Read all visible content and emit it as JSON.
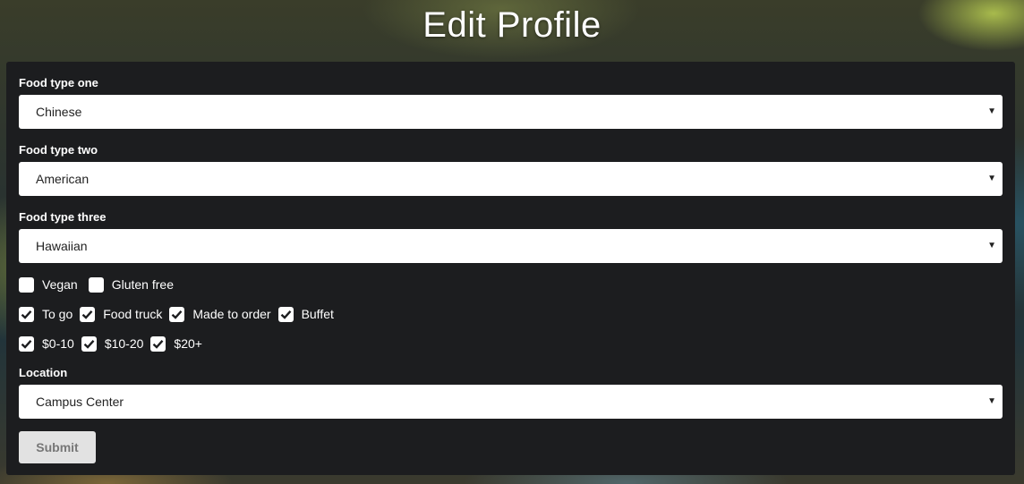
{
  "title": "Edit Profile",
  "fields": [
    {
      "label": "Food type one",
      "value": "Chinese"
    },
    {
      "label": "Food type two",
      "value": "American"
    },
    {
      "label": "Food type three",
      "value": "Hawaiian"
    }
  ],
  "dietary": [
    {
      "label": "Vegan",
      "checked": false
    },
    {
      "label": "Gluten free",
      "checked": false
    }
  ],
  "service": [
    {
      "label": "To go",
      "checked": true
    },
    {
      "label": "Food truck",
      "checked": true
    },
    {
      "label": "Made to order",
      "checked": true
    },
    {
      "label": "Buffet",
      "checked": true
    }
  ],
  "price": [
    {
      "label": "$0-10",
      "checked": true
    },
    {
      "label": "$10-20",
      "checked": true
    },
    {
      "label": "$20+",
      "checked": true
    }
  ],
  "location": {
    "label": "Location",
    "value": "Campus Center"
  },
  "submit_label": "Submit",
  "icons": {
    "dropdown": "caret-down-icon",
    "check": "checkmark-icon"
  },
  "colors": {
    "card": "#1c1d1f",
    "button": "#e2e2e2"
  }
}
